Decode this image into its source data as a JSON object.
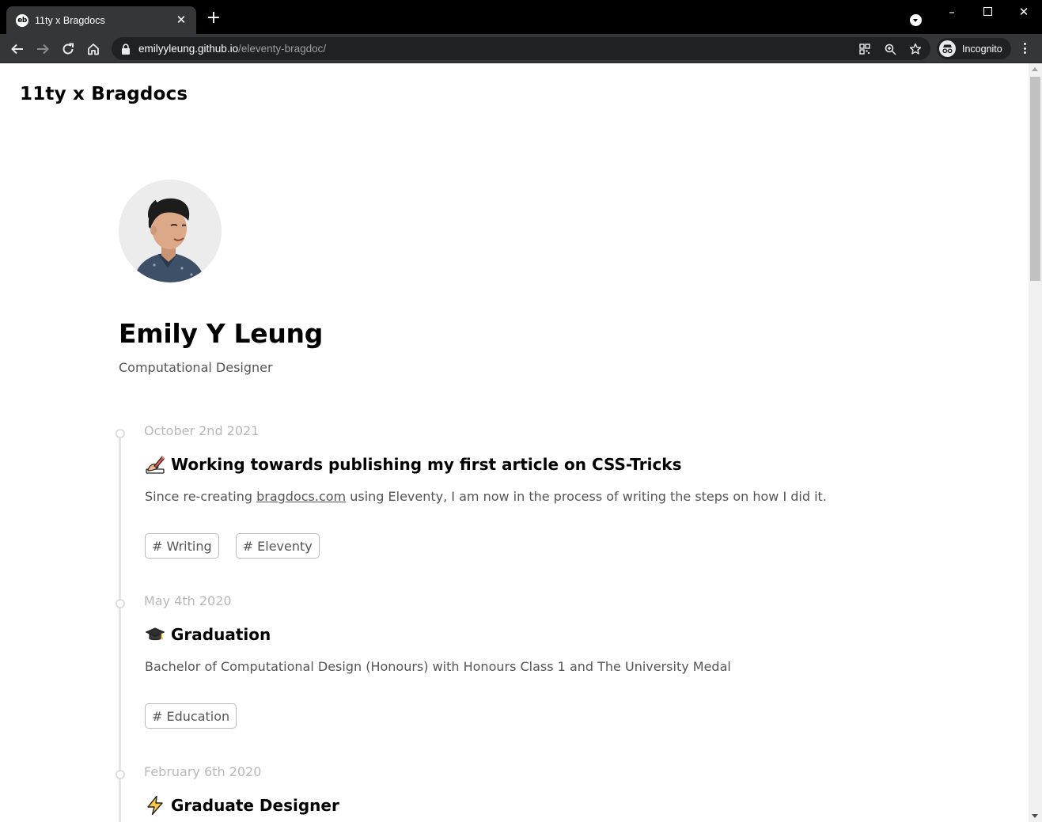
{
  "browser": {
    "tab_title": "11ty x Bragdocs",
    "tab_favicon_text": "eb",
    "url_host": "emilyyleung.github.io",
    "url_path": "/eleventy-bragdoc/",
    "profile_label": "Incognito"
  },
  "site": {
    "title": "11ty x Bragdocs"
  },
  "profile": {
    "name": "Emily Y Leung",
    "role": "Computational Designer"
  },
  "entries": [
    {
      "date": "October 2nd 2021",
      "emoji": "writing-hand-icon",
      "title": "Working towards publishing my first article on CSS-Tricks",
      "desc_before": "Since re-creating ",
      "desc_link": "bragdocs.com",
      "desc_after": " using Eleventy, I am now in the process of writing the steps on how I did it.",
      "tags": [
        "# Writing",
        "# Eleventy"
      ]
    },
    {
      "date": "May 4th 2020",
      "emoji": "graduation-cap-icon",
      "title": "Graduation",
      "desc": "Bachelor of Computational Design (Honours) with Honours Class 1 and The University Medal",
      "tags": [
        "# Education"
      ]
    },
    {
      "date": "February 6th 2020",
      "emoji": "lightning-icon",
      "title": "Graduate Designer"
    }
  ],
  "colors": {
    "chrome_dark": "#000000",
    "toolbar": "#35363a",
    "omnibox": "#202124",
    "muted_text": "#555555",
    "date_text": "#b8b8b8"
  }
}
